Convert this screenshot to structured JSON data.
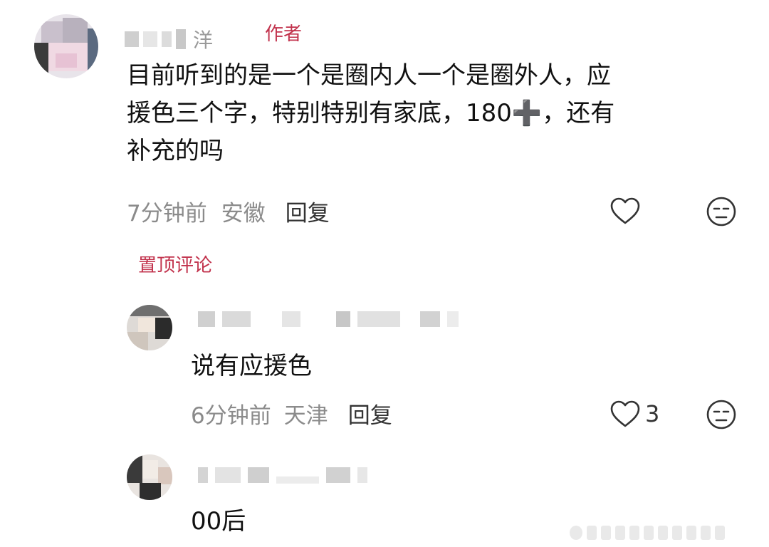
{
  "comments": [
    {
      "username_visible": "洋",
      "author_tag": "作者",
      "text_lines": [
        "目前听到的是一个是圈内人一个是圈外人，应",
        "援色三个字，特别特别有家底，180➕，还有",
        "补充的吗"
      ],
      "time": "7分钟前",
      "location": "安徽",
      "reply_label": "回复"
    }
  ],
  "pinned_label": "置顶评论",
  "replies": [
    {
      "text": "说有应援色",
      "time": "6分钟前",
      "location": "天津",
      "reply_label": "回复",
      "like_count": "3"
    },
    {
      "text": "00后"
    }
  ],
  "colors": {
    "author_tag": "#c2334d",
    "meta_text": "#8b8b8b",
    "body_text": "#111111"
  },
  "icons": [
    "heart-icon",
    "meh-face-icon"
  ]
}
